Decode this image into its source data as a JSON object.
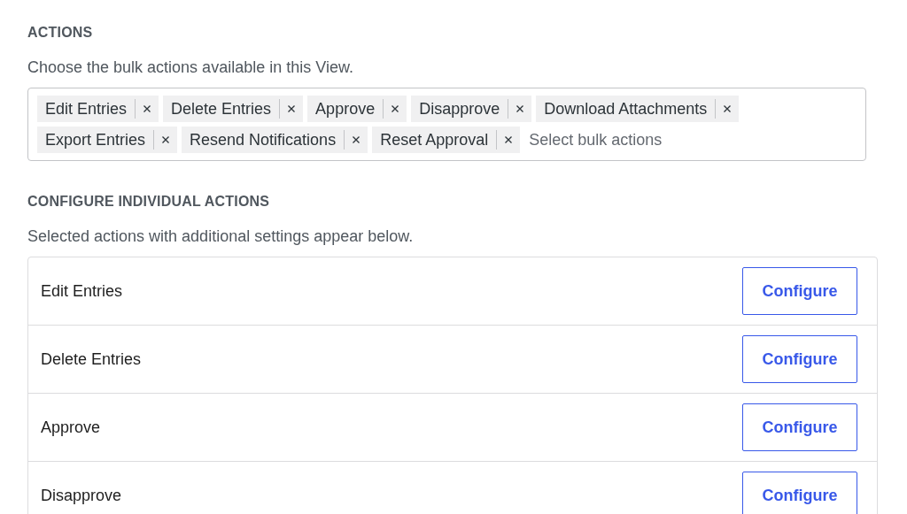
{
  "actions": {
    "heading": "ACTIONS",
    "description": "Choose the bulk actions available in this View.",
    "selected": [
      {
        "label": "Edit Entries"
      },
      {
        "label": "Delete Entries"
      },
      {
        "label": "Approve"
      },
      {
        "label": "Disapprove"
      },
      {
        "label": "Download Attachments"
      },
      {
        "label": "Export Entries"
      },
      {
        "label": "Resend Notifications"
      },
      {
        "label": "Reset Approval"
      }
    ],
    "placeholder": "Select bulk actions"
  },
  "configure": {
    "heading": "CONFIGURE INDIVIDUAL ACTIONS",
    "description": "Selected actions with additional settings appear below.",
    "rows": [
      {
        "name": "Edit Entries",
        "button": "Configure"
      },
      {
        "name": "Delete Entries",
        "button": "Configure"
      },
      {
        "name": "Approve",
        "button": "Configure"
      },
      {
        "name": "Disapprove",
        "button": "Configure"
      }
    ]
  }
}
